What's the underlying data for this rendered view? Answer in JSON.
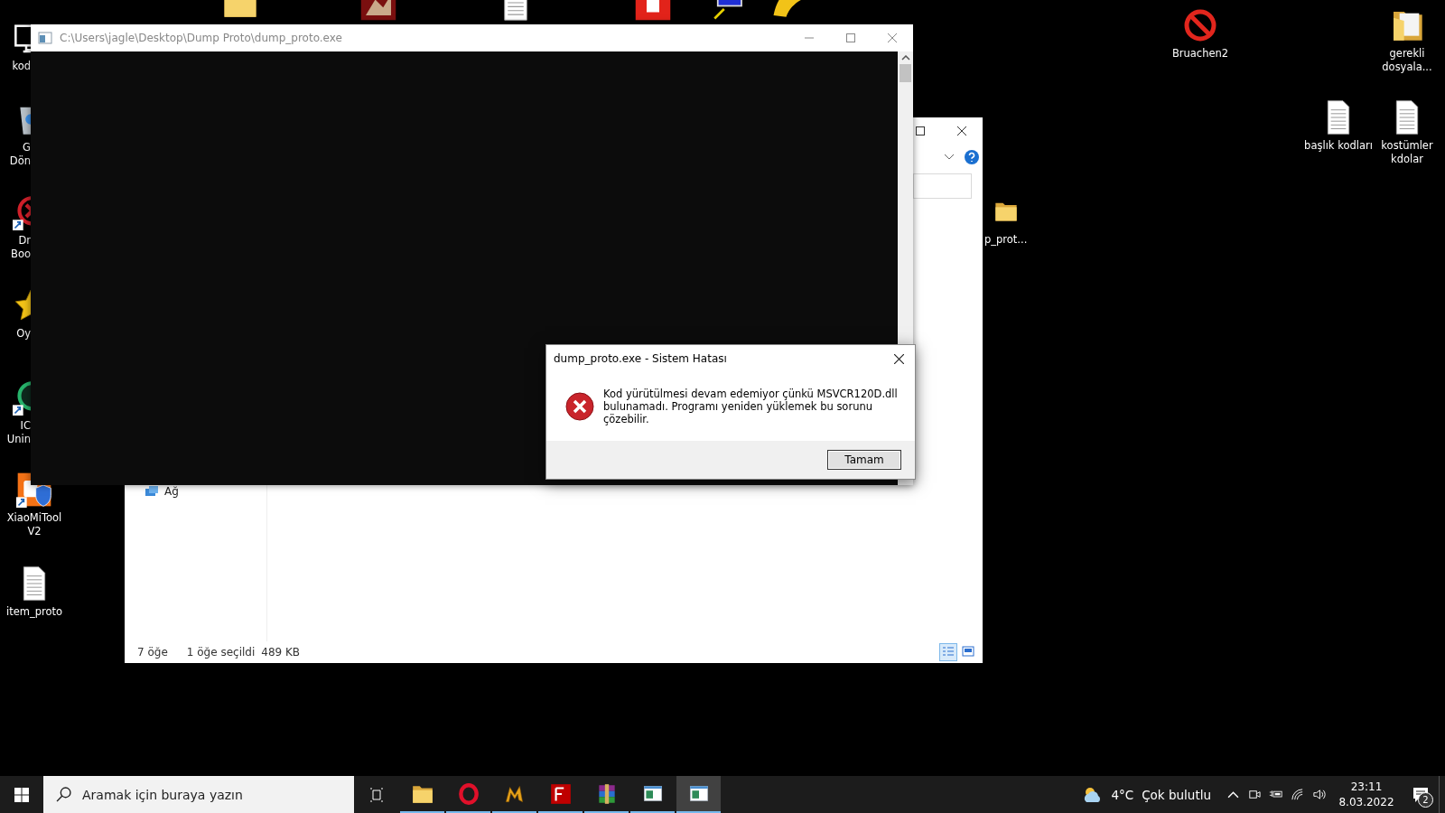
{
  "desktop": {
    "left_icons": [
      {
        "kind": "computer",
        "lines": [
          "kod"
        ]
      },
      {
        "kind": "recycle",
        "lines": [
          "G",
          "Dön"
        ]
      },
      {
        "kind": "ring-red",
        "lines": [
          "Dr",
          "Boo"
        ]
      },
      {
        "kind": "star",
        "lines": [
          "Oy"
        ]
      },
      {
        "kind": "ring-green",
        "lines": [
          "IC",
          "Unin"
        ]
      },
      {
        "kind": "android",
        "lines": [
          "XiaoMiTool",
          "V2"
        ]
      },
      {
        "kind": "document",
        "lines": [
          "item_proto"
        ]
      }
    ],
    "top_icons": [
      {
        "kind": "folder"
      },
      {
        "kind": "thumb"
      },
      {
        "kind": "document"
      },
      {
        "kind": "stamp"
      },
      {
        "kind": "netpc"
      },
      {
        "kind": "wedge"
      }
    ],
    "right_icons": [
      {
        "kind": "prohibited",
        "lines": [
          "Bruachen2"
        ]
      },
      {
        "kind": "folder-doc",
        "lines": [
          "gerekli",
          "dosyala..."
        ]
      },
      {
        "kind": "document",
        "lines": [
          "başlık kodları"
        ]
      },
      {
        "kind": "document",
        "lines": [
          "kostümler",
          "kdolar"
        ]
      },
      {
        "kind": "folder",
        "lines": [
          "p_prot..."
        ]
      }
    ]
  },
  "explorer": {
    "sidebar_items": [
      {
        "label": "Ağ"
      }
    ],
    "status_bar": {
      "item_count": "7 öğe",
      "selection": "1 öğe seçildi",
      "size": "489 KB"
    },
    "view_buttons": [
      {
        "selected": true
      },
      {
        "selected": false
      }
    ]
  },
  "console": {
    "title": "C:\\Users\\jagle\\Desktop\\Dump Proto\\dump_proto.exe"
  },
  "dialog": {
    "title": "dump_proto.exe - Sistem Hatası",
    "message": "Kod yürütülmesi devam edemiyor çünkü MSVCR120D.dll bulunamadı. Programı yeniden yüklemek bu sorunu çözebilir.",
    "button": "Tamam"
  },
  "taskbar": {
    "search": {
      "placeholder": "Aramak için buraya yazın"
    },
    "apps": [
      {
        "kind": "folder",
        "selected": false
      },
      {
        "kind": "opera",
        "selected": false
      },
      {
        "kind": "m2",
        "selected": false
      },
      {
        "kind": "fz",
        "selected": false
      },
      {
        "kind": "rar",
        "selected": false
      },
      {
        "kind": "window",
        "selected": false
      },
      {
        "kind": "window",
        "selected": true
      }
    ],
    "weather": {
      "temperature": "4°C",
      "condition": "Çok bulutlu"
    },
    "clock": {
      "time": "23:11",
      "date": "8.03.2022"
    },
    "notifications": {
      "count": "2"
    }
  }
}
